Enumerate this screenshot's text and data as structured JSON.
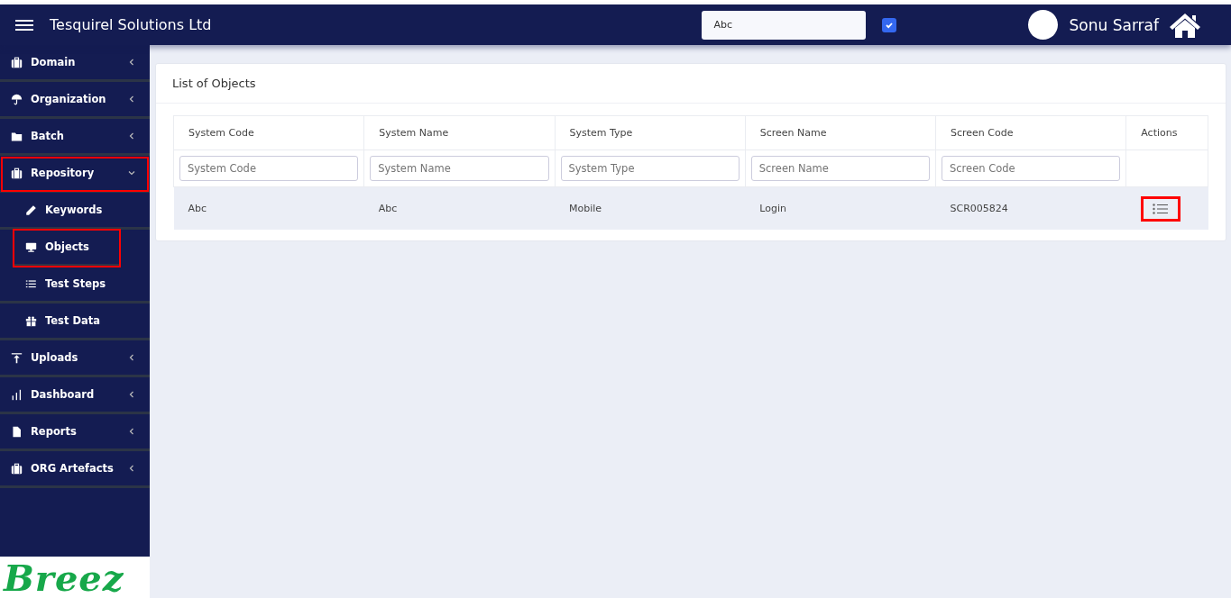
{
  "header": {
    "title": "Tesquirel Solutions Ltd",
    "select_value": "Abc",
    "checkbox_checked": true,
    "user_name": "Sonu Sarraf"
  },
  "sidebar": {
    "items": [
      {
        "label": "Domain",
        "expanded": false,
        "highlighted": false
      },
      {
        "label": "Organization",
        "expanded": false,
        "highlighted": false
      },
      {
        "label": "Batch",
        "expanded": false,
        "highlighted": false
      },
      {
        "label": "Repository",
        "expanded": true,
        "highlighted": true,
        "children": [
          {
            "label": "Keywords",
            "highlighted": false
          },
          {
            "label": "Objects",
            "highlighted": true
          },
          {
            "label": "Test Steps",
            "highlighted": false
          },
          {
            "label": "Test Data",
            "highlighted": false
          }
        ]
      },
      {
        "label": "Uploads",
        "expanded": false,
        "highlighted": false
      },
      {
        "label": "Dashboard",
        "expanded": false,
        "highlighted": false
      },
      {
        "label": "Reports",
        "expanded": false,
        "highlighted": false
      },
      {
        "label": "ORG Artefacts",
        "expanded": false,
        "highlighted": false
      }
    ],
    "logo": "Breez"
  },
  "panel": {
    "title": "List of Objects",
    "table": {
      "columns": [
        "System Code",
        "System Name",
        "System Type",
        "Screen Name",
        "Screen Code",
        "Actions"
      ],
      "filters": [
        {
          "placeholder": "System Code"
        },
        {
          "placeholder": "System Name"
        },
        {
          "placeholder": "System Type"
        },
        {
          "placeholder": "Screen Name"
        },
        {
          "placeholder": "Screen Code"
        }
      ],
      "rows": [
        {
          "cells": [
            "Abc",
            "Abc",
            "Mobile",
            "Login",
            "SCR005824"
          ],
          "action_highlighted": true
        }
      ]
    }
  }
}
